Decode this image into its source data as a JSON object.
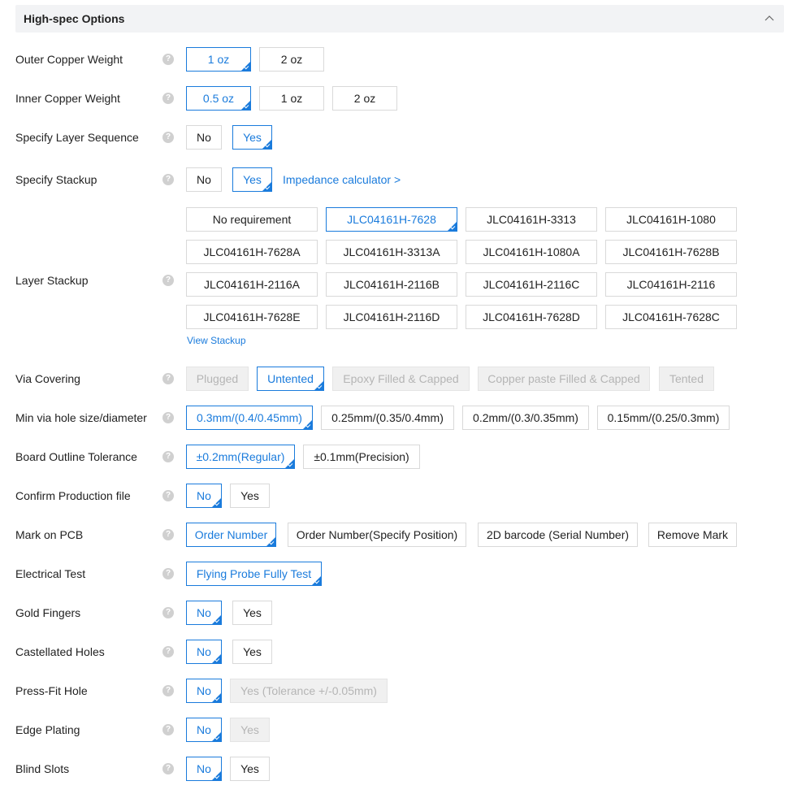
{
  "header": {
    "title": "High-spec Options"
  },
  "help_glyph": "?",
  "rows": {
    "outer_copper": {
      "label": "Outer Copper Weight",
      "options": [
        "1 oz",
        "2 oz"
      ],
      "selected": "1 oz"
    },
    "inner_copper": {
      "label": "Inner Copper Weight",
      "options": [
        "0.5 oz",
        "1 oz",
        "2 oz"
      ],
      "selected": "0.5 oz"
    },
    "layer_sequence": {
      "label": "Specify Layer Sequence",
      "options": [
        "No",
        "Yes"
      ],
      "selected": "Yes"
    },
    "stackup": {
      "label": "Specify Stackup",
      "options": [
        "No",
        "Yes"
      ],
      "selected": "Yes",
      "link": "Impedance calculator >"
    },
    "layer_stackup": {
      "label": "Layer Stackup",
      "options": [
        "No requirement",
        "JLC04161H-7628",
        "JLC04161H-3313",
        "JLC04161H-1080",
        "JLC04161H-7628A",
        "JLC04161H-3313A",
        "JLC04161H-1080A",
        "JLC04161H-7628B",
        "JLC04161H-2116A",
        "JLC04161H-2116B",
        "JLC04161H-2116C",
        "JLC04161H-2116",
        "JLC04161H-7628E",
        "JLC04161H-2116D",
        "JLC04161H-7628D",
        "JLC04161H-7628C"
      ],
      "selected": "JLC04161H-7628",
      "link": "View Stackup"
    },
    "via_covering": {
      "label": "Via Covering",
      "options": [
        "Plugged",
        "Untented",
        "Epoxy Filled & Capped",
        "Copper paste Filled & Capped",
        "Tented"
      ],
      "selected": "Untented",
      "disabled": [
        "Plugged",
        "Epoxy Filled & Capped",
        "Copper paste Filled & Capped",
        "Tented"
      ]
    },
    "min_via": {
      "label": "Min via hole size/diameter",
      "options": [
        "0.3mm/(0.4/0.45mm)",
        "0.25mm/(0.35/0.4mm)",
        "0.2mm/(0.3/0.35mm)",
        "0.15mm/(0.25/0.3mm)"
      ],
      "selected": "0.3mm/(0.4/0.45mm)"
    },
    "outline_tolerance": {
      "label": "Board Outline Tolerance",
      "options": [
        "±0.2mm(Regular)",
        "±0.1mm(Precision)"
      ],
      "selected": "±0.2mm(Regular)"
    },
    "confirm_file": {
      "label": "Confirm Production file",
      "options": [
        "No",
        "Yes"
      ],
      "selected": "No"
    },
    "mark_pcb": {
      "label": "Mark on PCB",
      "options": [
        "Order Number",
        "Order Number(Specify Position)",
        "2D barcode (Serial Number)",
        "Remove Mark"
      ],
      "selected": "Order Number"
    },
    "electrical_test": {
      "label": "Electrical Test",
      "options": [
        "Flying Probe Fully Test"
      ],
      "selected": "Flying Probe Fully Test"
    },
    "gold_fingers": {
      "label": "Gold Fingers",
      "options": [
        "No",
        "Yes"
      ],
      "selected": "No"
    },
    "castellated": {
      "label": "Castellated Holes",
      "options": [
        "No",
        "Yes"
      ],
      "selected": "No"
    },
    "press_fit": {
      "label": "Press-Fit Hole",
      "options": [
        "No",
        "Yes (Tolerance +/-0.05mm)"
      ],
      "selected": "No",
      "disabled": [
        "Yes (Tolerance +/-0.05mm)"
      ]
    },
    "edge_plating": {
      "label": "Edge Plating",
      "options": [
        "No",
        "Yes"
      ],
      "selected": "No",
      "disabled": [
        "Yes"
      ]
    },
    "blind_slots": {
      "label": "Blind Slots",
      "options": [
        "No",
        "Yes"
      ],
      "selected": "No"
    }
  },
  "colors": {
    "accent": "#1a7bdc",
    "border": "#d9d9d9",
    "disabled_bg": "#f0f0f0",
    "disabled_text": "#b5b5b5",
    "header_bg": "#f2f3f5"
  }
}
